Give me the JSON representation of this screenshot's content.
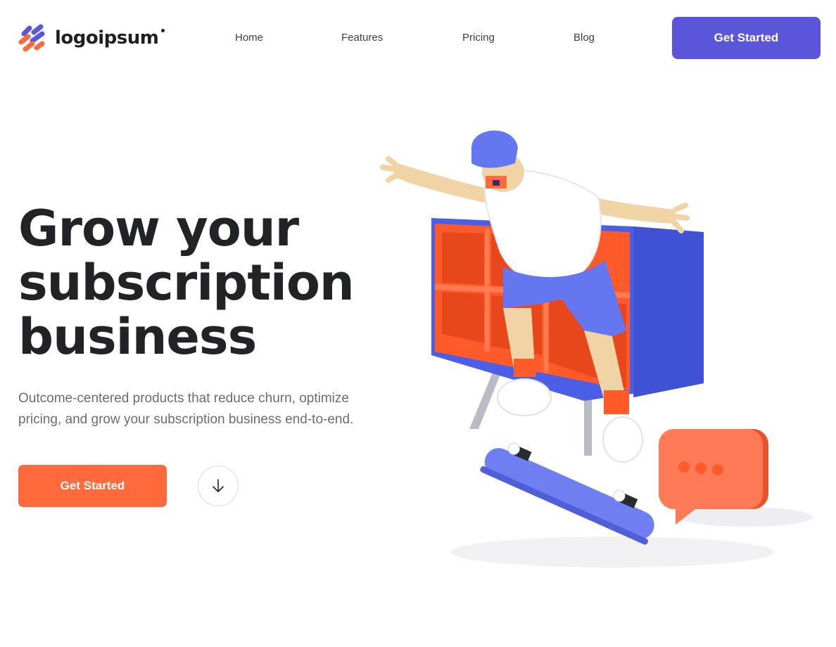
{
  "header": {
    "logo_text": "logoipsum",
    "nav": [
      {
        "label": "Home"
      },
      {
        "label": "Features"
      },
      {
        "label": "Pricing"
      },
      {
        "label": "Blog"
      }
    ],
    "cta_label": "Get Started"
  },
  "hero": {
    "title_lines": [
      "Grow your",
      "subscription",
      "business"
    ],
    "subtitle_lines": [
      "Outcome-centered products that reduce churn, optimize",
      "pricing, and grow your subscription business end-to-end."
    ],
    "cta_label": "Get Started",
    "scroll_icon": "arrow-down-icon"
  },
  "icons": {
    "logo": "logo-mark-icon",
    "illustration": "skateboarder-illustration"
  },
  "colors": {
    "brand_purple": "#5a55d9",
    "accent_orange": "#ff6a3d",
    "text_dark": "#222326",
    "text_muted": "#6b6c72",
    "illustration_blue": "#4a5ee6",
    "illustration_orange": "#ff5a2a"
  }
}
